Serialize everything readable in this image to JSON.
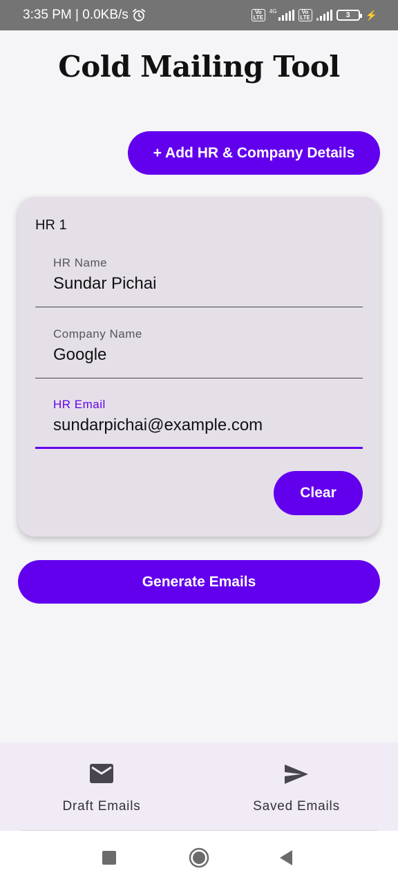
{
  "status_bar": {
    "time_speed": "3:35 PM | 0.0KB/s",
    "network_label": "4G",
    "volte_label_top": "Vo",
    "volte_label_bottom": "LTE",
    "battery": "3"
  },
  "app": {
    "title": "Cold Mailing Tool"
  },
  "actions": {
    "add_label": "+ Add HR & Company Details",
    "generate_label": "Generate Emails"
  },
  "card": {
    "title": "HR 1",
    "fields": [
      {
        "label": "HR Name",
        "value": "Sundar Pichai"
      },
      {
        "label": "Company Name",
        "value": "Google"
      },
      {
        "label": "HR Email",
        "value": "sundarpichai@example.com"
      }
    ],
    "clear_label": "Clear"
  },
  "bottom_nav": {
    "items": [
      {
        "label": "Draft Emails",
        "icon": "mail-icon"
      },
      {
        "label": "Saved Emails",
        "icon": "send-icon"
      }
    ]
  },
  "colors": {
    "accent": "#6200ee",
    "card_bg": "#e5e0e8",
    "nav_bg": "#f1ebf6"
  }
}
